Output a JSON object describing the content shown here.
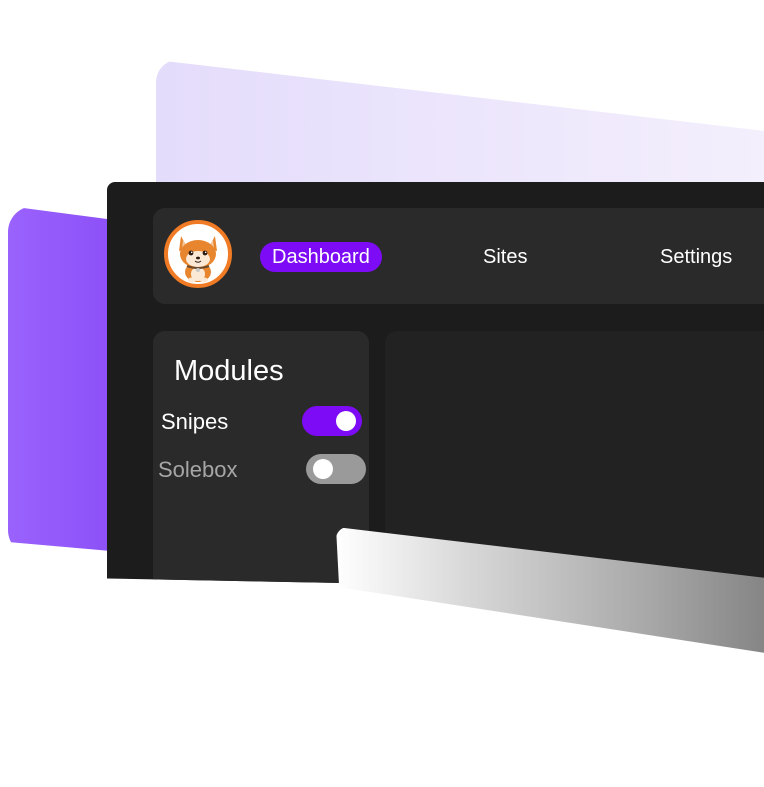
{
  "nav": {
    "items": [
      {
        "label": "Dashboard",
        "active": true
      },
      {
        "label": "Sites",
        "active": false
      },
      {
        "label": "Settings",
        "active": false
      }
    ]
  },
  "avatar": {
    "icon": "shiba-inu-dog-icon"
  },
  "modules": {
    "title": "Modules",
    "items": [
      {
        "label": "Snipes",
        "enabled": true
      },
      {
        "label": "Solebox",
        "enabled": false
      }
    ]
  },
  "colors": {
    "accent": "#7d0bf6",
    "window": "#1c1c1c",
    "panel": "#2a2a2a",
    "toggle_off": "#9a9a9a",
    "avatar_ring": "#f07b24",
    "brand_purple": "#9a62fd",
    "lavender": "#efe9fc"
  }
}
